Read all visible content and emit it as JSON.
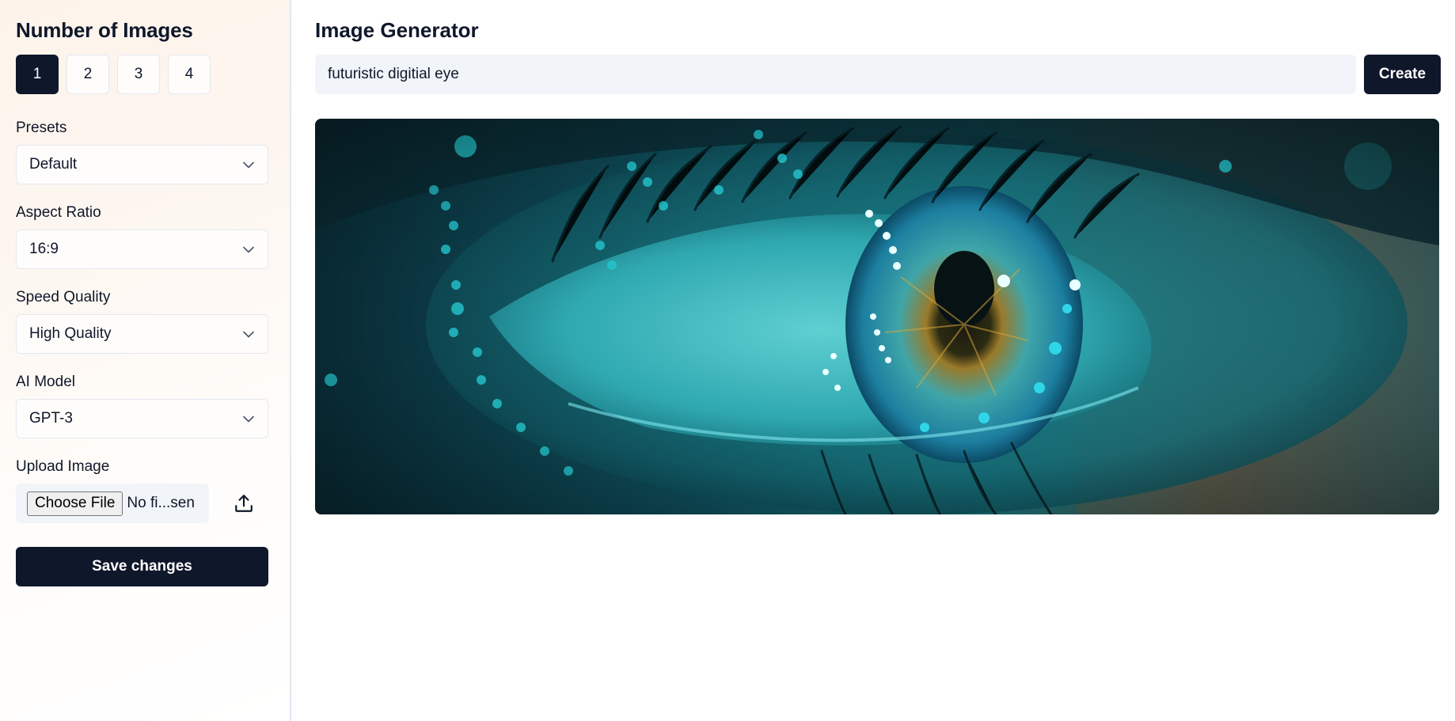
{
  "sidebar": {
    "title": "Number of Images",
    "counts": [
      "1",
      "2",
      "3",
      "4"
    ],
    "selected_count": "1",
    "presets": {
      "label": "Presets",
      "value": "Default"
    },
    "aspect_ratio": {
      "label": "Aspect Ratio",
      "value": "16:9"
    },
    "speed_quality": {
      "label": "Speed Quality",
      "value": "High Quality"
    },
    "ai_model": {
      "label": "AI Model",
      "value": "GPT-3"
    },
    "upload": {
      "label": "Upload Image",
      "button_label": "Choose File",
      "status": "No fi...sen",
      "icon": "upload-icon"
    },
    "save_label": "Save changes"
  },
  "main": {
    "title": "Image Generator",
    "prompt_value": "futuristic digitial eye",
    "create_label": "Create",
    "image": {
      "subject": "futuristic digital eye",
      "icon": "generated-image"
    }
  },
  "colors": {
    "primary": "#0f172a",
    "input_bg": "#f1f5f9",
    "border": "#e2e8f0"
  }
}
